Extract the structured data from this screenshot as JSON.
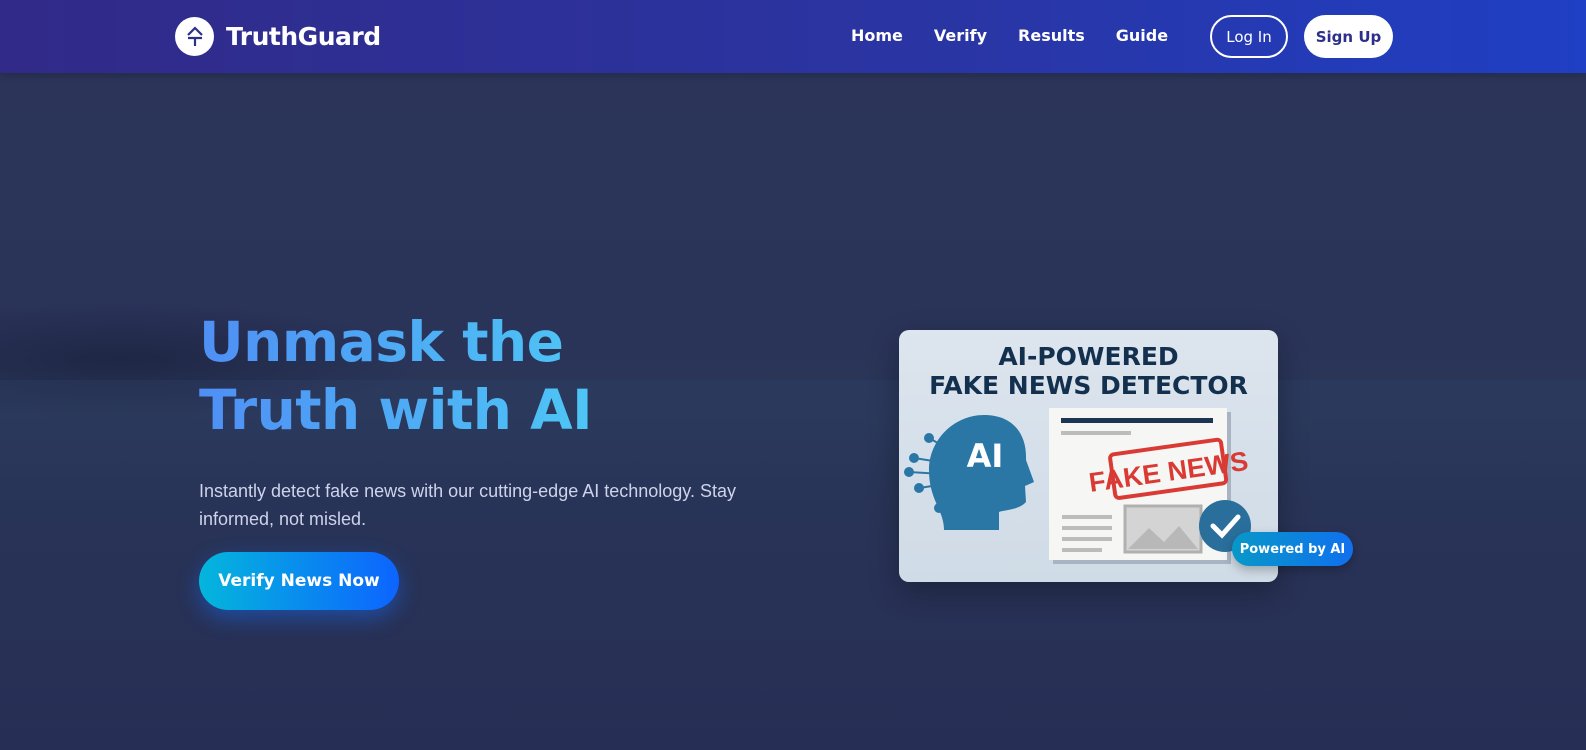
{
  "nav": {
    "brand": "TruthGuard",
    "links": [
      "Home",
      "Verify",
      "Results",
      "Guide"
    ],
    "login": "Log In",
    "signup": "Sign Up"
  },
  "hero": {
    "title": "Unmask the Truth with AI",
    "subtitle": "Instantly detect fake news with our cutting-edge AI technology. Stay informed, not misled.",
    "cta": "Verify News Now"
  },
  "illustration": {
    "title_line1": "AI-POWERED",
    "title_line2": "FAKE NEWS DETECTOR",
    "head_label": "AI",
    "stamp": "FAKE NEWS",
    "badge": "Powered by AI"
  },
  "colors": {
    "nav_start": "#312a88",
    "nav_end": "#1f3fc4",
    "accent": "#0d64ff",
    "stamp": "#d93a33"
  }
}
